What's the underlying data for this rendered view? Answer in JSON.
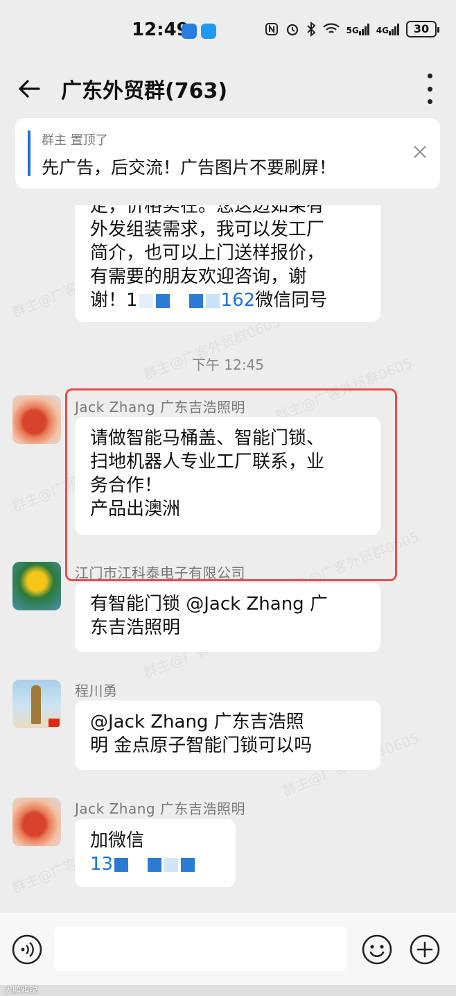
{
  "status_bar": {
    "time": "12:49",
    "battery": "30",
    "signal_1": "5G",
    "signal_2": "4G"
  },
  "header": {
    "title": "广东外贸群(763)"
  },
  "pinned": {
    "tag": "群主 置顶了",
    "text": "先广告，后交流！广告图片不要刷屏！"
  },
  "messages": {
    "first": {
      "lines": [
        "定，价格实在。您这边如果有",
        "外发组装需求，我可以发工厂",
        "简介，也可以上门送样报价，",
        "有需要的朋友欢迎咨询，谢"
      ],
      "last_prefix": "谢！1",
      "last_number": "162",
      "last_suffix": "微信同号"
    },
    "timestamp": "下午 12:45",
    "m1": {
      "sender": "Jack  Zhang  广东吉浩照明",
      "lines": [
        "请做智能马桶盖、智能门锁、",
        "扫地机器人专业工厂联系，业",
        "务合作！",
        "产品出澳洲"
      ]
    },
    "m2": {
      "sender": "江门市江科泰电子有限公司",
      "lines": [
        "有智能门锁 @Jack  Zhang  广",
        "东吉浩照明"
      ]
    },
    "m3": {
      "sender": "程川勇",
      "lines": [
        "@Jack  Zhang  广东吉浩照",
        "明 金点原子智能门锁可以吗"
      ]
    },
    "m4": {
      "sender": "Jack  Zhang  广东吉浩照明",
      "line1": "加微信",
      "line2": "13"
    }
  },
  "watermark": "群主@广客外贸群0605",
  "source_mark": "大鹏鸦锐",
  "colors": {
    "accent": "#1e6fe0",
    "highlight": "#e84d4d",
    "link": "#1a72d9"
  },
  "icons": [
    "back-arrow-icon",
    "more-vertical-icon",
    "close-icon",
    "voice-icon",
    "emoji-icon",
    "plus-icon"
  ]
}
